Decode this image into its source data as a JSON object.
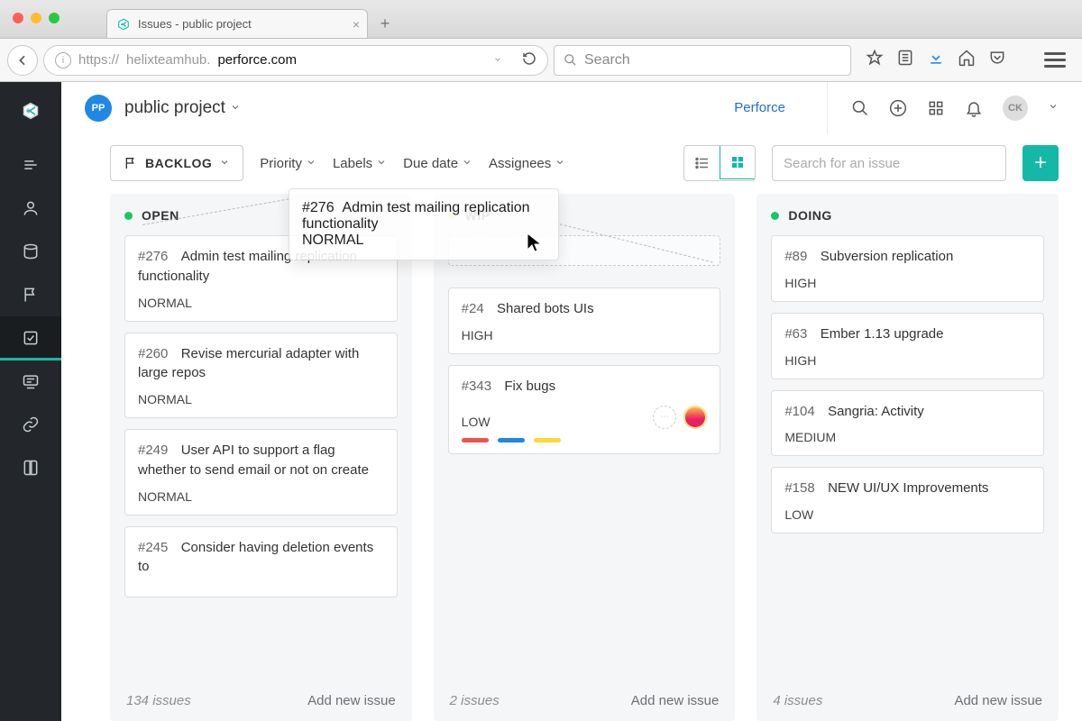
{
  "browser": {
    "tab_title": "Issues - public project",
    "url_proto": "https://",
    "url_host_muted": "helixteamhub.",
    "url_host_dark": "perforce.com",
    "search_placeholder": "Search"
  },
  "app": {
    "project_short": "PP",
    "project_name": "public project",
    "org_link": "Perforce",
    "avatar_initials": "CK"
  },
  "toolbar": {
    "view_label": "BACKLOG",
    "filters": {
      "priority": "Priority",
      "labels": "Labels",
      "due": "Due date",
      "assignees": "Assignees"
    },
    "search_placeholder": "Search for an issue"
  },
  "colors": {
    "open": "#17c964",
    "wip": "#b7e05a",
    "doing": "#17c964",
    "tag_red": "#ef5350",
    "tag_blue": "#1e88e5",
    "tag_yellow": "#fdd835"
  },
  "dragging": {
    "num": "#276",
    "title": "Admin test mailing replication functionality",
    "priority": "NORMAL"
  },
  "columns": {
    "open": {
      "title": "OPEN",
      "count_text": "134 issues",
      "add_text": "Add new issue",
      "cards": [
        {
          "num": "#276",
          "title": "Admin test mailing replication functionality",
          "priority": "NORMAL"
        },
        {
          "num": "#260",
          "title": "Revise mercurial adapter with large repos",
          "priority": "NORMAL"
        },
        {
          "num": "#249",
          "title": "User API to support a flag whether to send email or not on create",
          "priority": "NORMAL"
        },
        {
          "num": "#245",
          "title": "Consider having deletion events to",
          "priority": ""
        }
      ]
    },
    "wip": {
      "title": "WIP",
      "count_text": "2 issues",
      "add_text": "Add new issue",
      "cards": [
        {
          "num": "#24",
          "title": "Shared bots UIs",
          "priority": "HIGH"
        },
        {
          "num": "#343",
          "title": "Fix bugs",
          "priority": "LOW",
          "assignees": true,
          "tags": true
        }
      ]
    },
    "doing": {
      "title": "DOING",
      "count_text": "4 issues",
      "add_text": "Add new issue",
      "cards": [
        {
          "num": "#89",
          "title": "Subversion replication",
          "priority": "HIGH"
        },
        {
          "num": "#63",
          "title": "Ember 1.13 upgrade",
          "priority": "HIGH"
        },
        {
          "num": "#104",
          "title": "Sangria: Activity",
          "priority": "MEDIUM"
        },
        {
          "num": "#158",
          "title": "NEW UI/UX Improvements",
          "priority": "LOW"
        }
      ]
    }
  }
}
